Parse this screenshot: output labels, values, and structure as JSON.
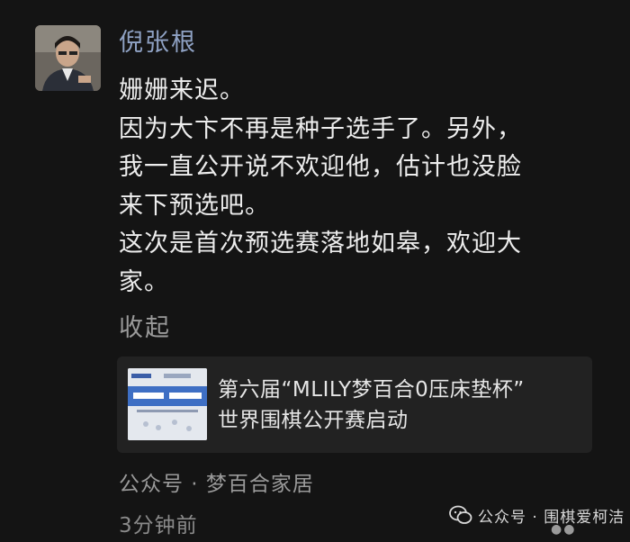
{
  "post": {
    "author": "倪张根",
    "lines": [
      "姗姗来迟。",
      "因为大卞不再是种子选手了。另外，",
      "我一直公开说不欢迎他，估计也没脸",
      "来下预选吧。",
      "这次是首次预选赛落地如皋，欢迎大",
      "家。"
    ],
    "collapse_label": "收起"
  },
  "shared_card": {
    "title_line1": "第六届“MLILY梦百合0压床垫杯”",
    "title_line2": "世界围棋公开赛启动",
    "thumb_text": "白天围棋手 超越梦百合"
  },
  "source": "公众号 · 梦百合家居",
  "timestamp": "3分钟前",
  "watermark": "公众号 · 围棋爱柯洁",
  "icons": {
    "avatar": "avatar-photo",
    "watermark": "wechat-icon",
    "more": "more-dots-icon"
  }
}
